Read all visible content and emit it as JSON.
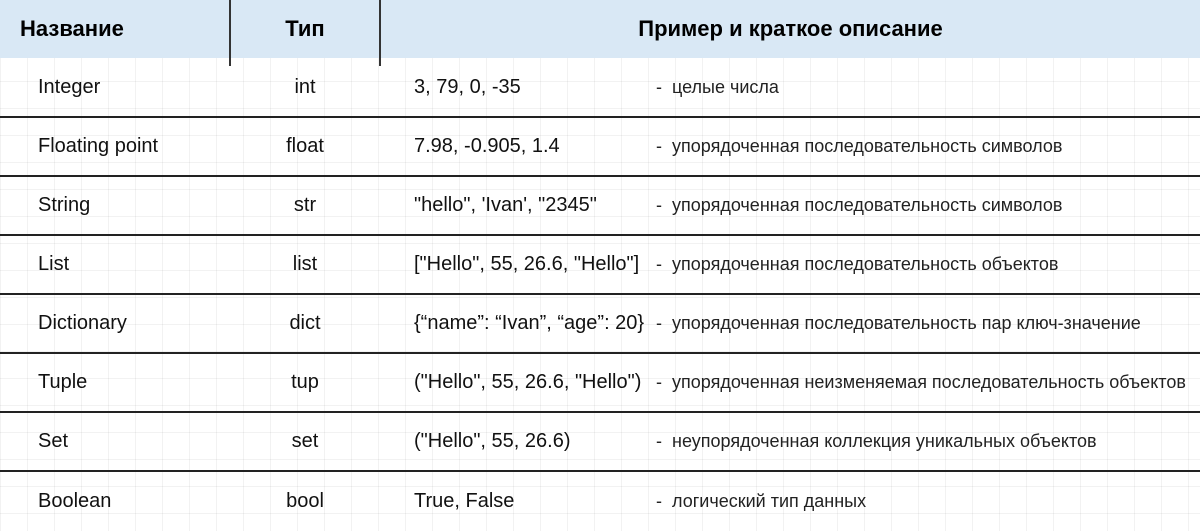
{
  "header": {
    "name": "Название",
    "type": "Тип",
    "desc": "Пример и краткое описание"
  },
  "rows": [
    {
      "name": "Integer",
      "type": "int",
      "example": "3, 79, 0, -35",
      "desc": "целые числа"
    },
    {
      "name": "Floating point",
      "type": "float",
      "example": "7.98, -0.905, 1.4",
      "desc": "упорядоченная последовательность символов"
    },
    {
      "name": "String",
      "type": "str",
      "example": "\"hello\", 'Ivan', \"2345\"",
      "desc": "упорядоченная последовательность символов"
    },
    {
      "name": "List",
      "type": "list",
      "example": "[\"Hello\", 55, 26.6, \"Hello\"]",
      "desc": "упорядоченная последовательность объектов"
    },
    {
      "name": "Dictionary",
      "type": "dict",
      "example": "{“name”: “Ivan”, “age”: 20}",
      "desc": "упорядоченная последовательность пар ключ-значение"
    },
    {
      "name": "Tuple",
      "type": "tup",
      "example": "(\"Hello\", 55, 26.6, \"Hello\")",
      "desc": "упорядоченная неизменяемая последовательность объектов"
    },
    {
      "name": "Set",
      "type": "set",
      "example": "(\"Hello\", 55, 26.6)",
      "desc": "неупорядоченная коллекция уникальных объектов"
    },
    {
      "name": "Boolean",
      "type": "bool",
      "example": "True, False",
      "desc": "логический тип данных"
    }
  ],
  "dash": "-"
}
